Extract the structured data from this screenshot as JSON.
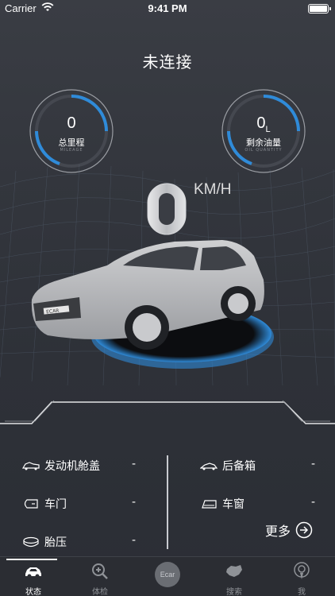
{
  "status_bar": {
    "carrier": "Carrier",
    "time": "9:41 PM"
  },
  "connection": {
    "title": "未连接"
  },
  "gauges": {
    "mileage": {
      "value": "0",
      "label": "总里程",
      "sub": "MILEAGE"
    },
    "fuel": {
      "value": "0",
      "unit": "L",
      "label": "剩余油量",
      "sub": "OIL QUANTITY"
    }
  },
  "speed": {
    "value": "0",
    "unit": "KM/H"
  },
  "car_plate": "ECAR",
  "status_items": {
    "hood": {
      "label": "发动机舱盖",
      "value": "-"
    },
    "trunk": {
      "label": "后备箱",
      "value": "-"
    },
    "door": {
      "label": "车门",
      "value": "-"
    },
    "window": {
      "label": "车窗",
      "value": "-"
    },
    "tire": {
      "label": "胎压",
      "value": "-"
    }
  },
  "more": {
    "label": "更多"
  },
  "tabs": [
    {
      "label": "状态",
      "icon": "car-icon",
      "active": true
    },
    {
      "label": "体检",
      "icon": "checkup-icon",
      "active": false
    },
    {
      "label": "Ecar",
      "icon": "ecar-logo-icon",
      "active": false
    },
    {
      "label": "搜索",
      "icon": "map-icon",
      "active": false
    },
    {
      "label": "我",
      "icon": "profile-icon",
      "active": false
    }
  ],
  "colors": {
    "accent": "#2f8bd9",
    "background": "#32353c",
    "tabbar": "#2b2d33"
  }
}
